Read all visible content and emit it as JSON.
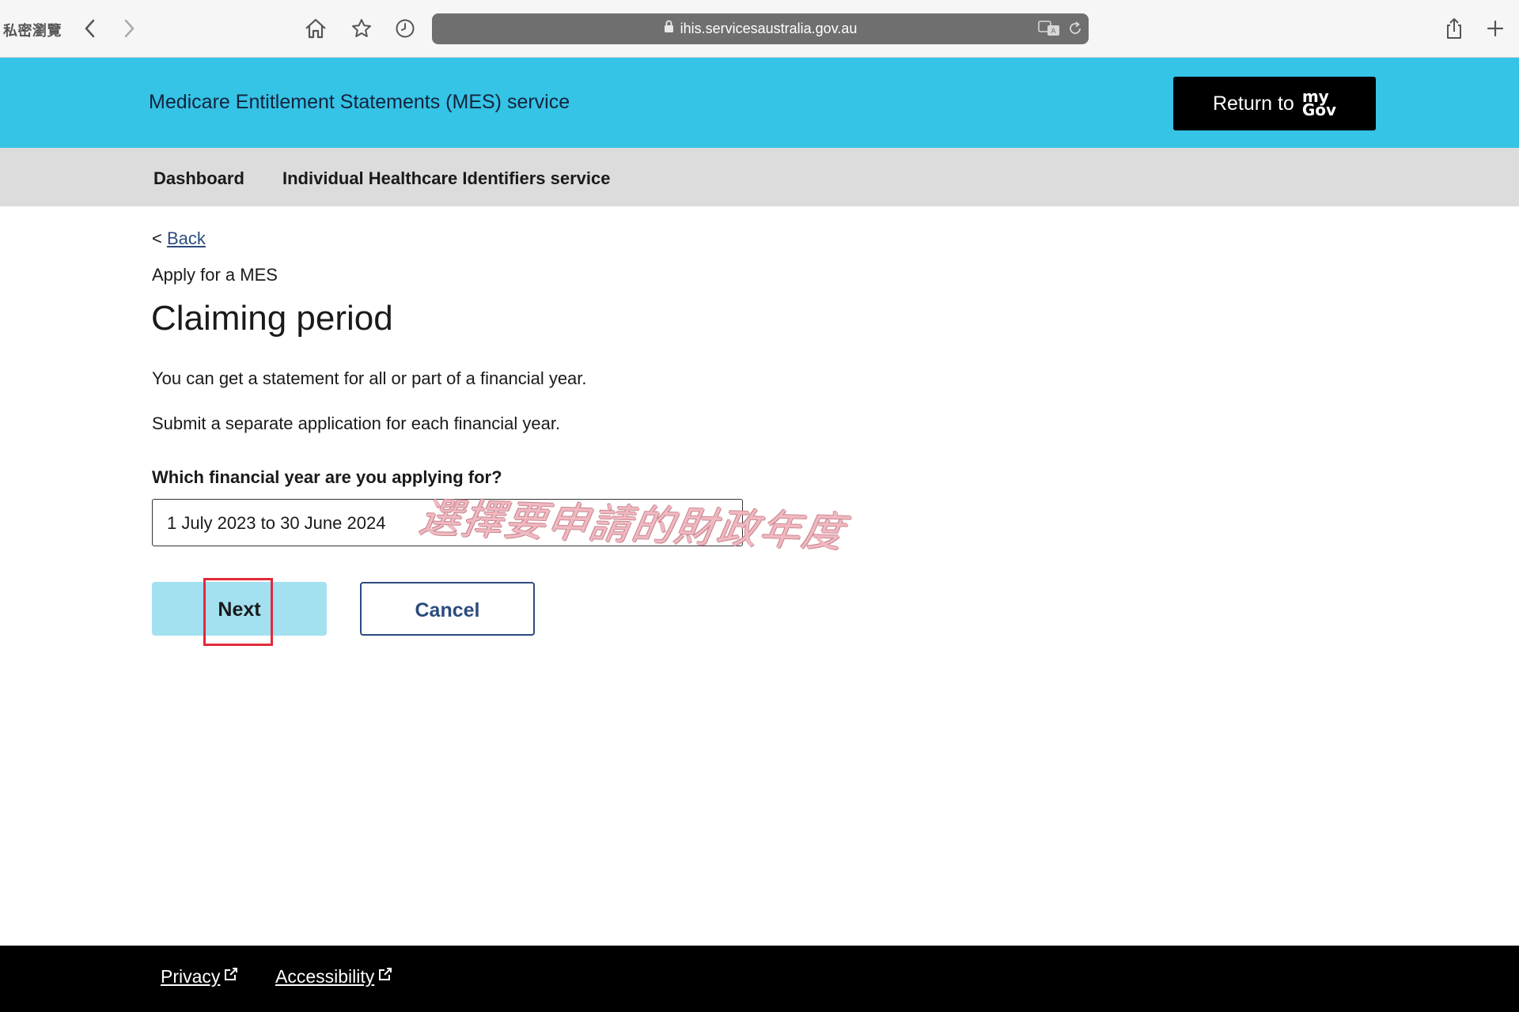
{
  "browser": {
    "private_label": "私密瀏覽",
    "url": "ihis.servicesaustralia.gov.au",
    "icons": [
      "back-icon",
      "forward-icon",
      "home-icon",
      "star-icon",
      "history-icon",
      "lock-icon",
      "translate-icon",
      "reload-icon",
      "share-icon",
      "new-tab-icon"
    ]
  },
  "header": {
    "title": "Medicare Entitlement Statements (MES) service",
    "return_label": "Return to",
    "mygov_top": "my",
    "mygov_bottom": "Gov"
  },
  "nav": {
    "items": [
      {
        "label": "Dashboard"
      },
      {
        "label": "Individual Healthcare Identifiers service"
      }
    ]
  },
  "main": {
    "back_prefix": "<",
    "back_label": "Back",
    "eyebrow": "Apply for a MES",
    "title": "Claiming period",
    "paragraphs": [
      "You can get a statement for all or part of a financial year.",
      "Submit a separate application for each financial year."
    ],
    "field_label": "Which financial year are you applying for?",
    "selected_year": "1 July 2023 to 30 June 2024",
    "annotation": "選擇要申請的財政年度",
    "next_label": "Next",
    "cancel_label": "Cancel"
  },
  "footer": {
    "links": [
      {
        "label": "Privacy"
      },
      {
        "label": "Accessibility"
      }
    ]
  },
  "colors": {
    "header_bg": "#35c3e6",
    "nav_bg": "#dcdcdc",
    "next_bg": "#a3e1f1",
    "cancel_border": "#2b4c7e",
    "highlight": "#e22a3a",
    "footer_bg": "#000000"
  }
}
